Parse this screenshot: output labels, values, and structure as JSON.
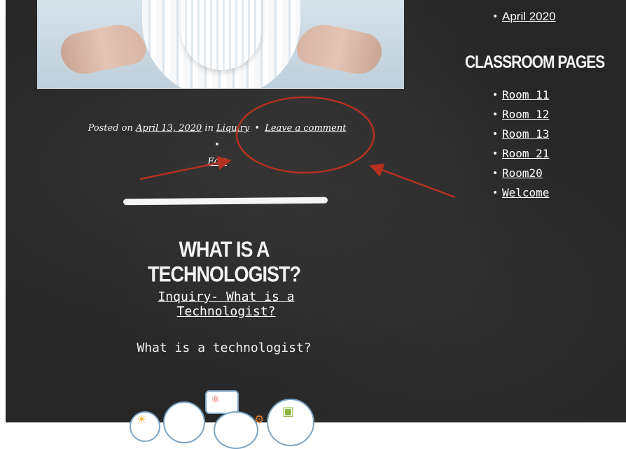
{
  "post": {
    "meta_prefix": "Posted on",
    "date": "April 13, 2020",
    "in_word": "in",
    "category": "Liquiry",
    "separator": "•",
    "comment_link": "Leave a comment",
    "edit_link": "Edit",
    "title": "WHAT IS A TECHNOLOGIST?",
    "inquiry_link": "Inquiry- What is a Technologist?",
    "question": "What is a technologist?"
  },
  "sidebar": {
    "archive_items": [
      "April 2020"
    ],
    "classroom_heading": "CLASSROOM PAGES",
    "classroom_items": [
      "Room 11",
      "Room 12",
      "Room 13",
      "Room 21",
      "Room20",
      "Welcome"
    ]
  },
  "colors": {
    "background": "#262626",
    "annotation": "#b5301f",
    "text": "#f3f3f3"
  }
}
